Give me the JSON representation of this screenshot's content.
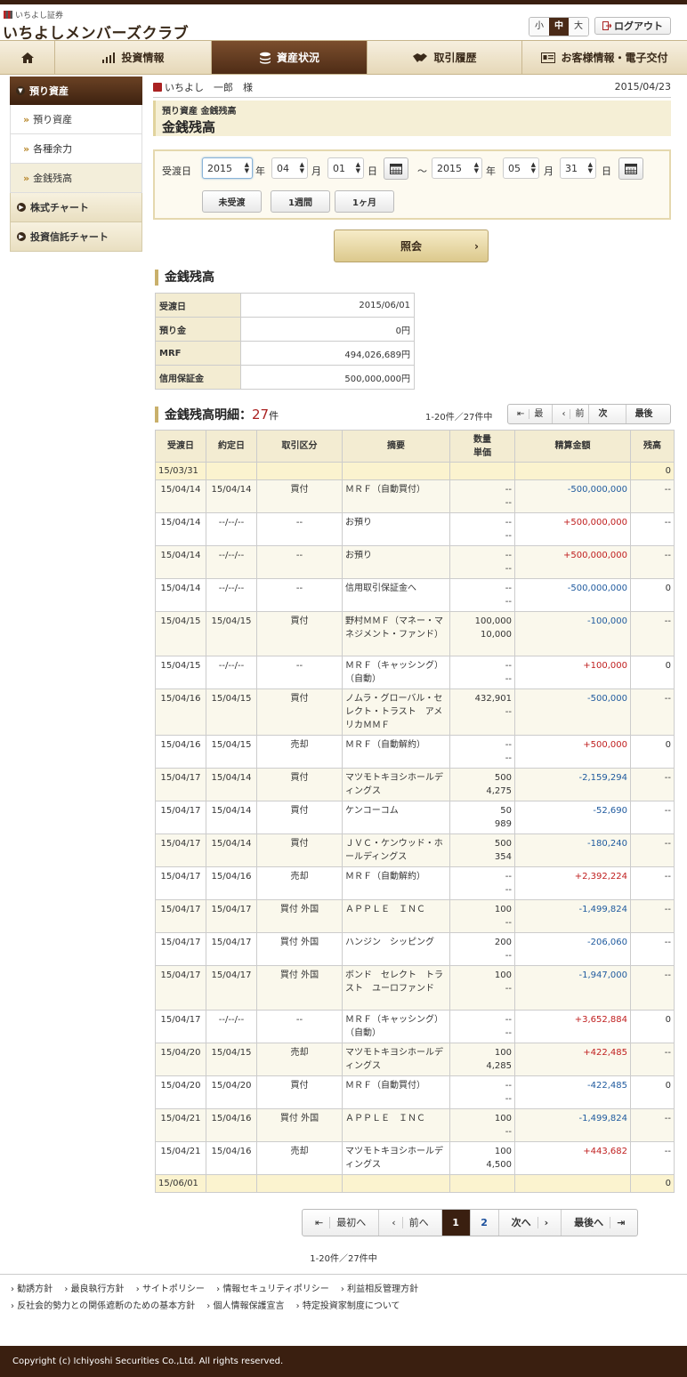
{
  "header": {
    "company_small": "いちよし証券",
    "site_title": "いちよしメンバーズクラブ",
    "font_sizes": [
      "小",
      "中",
      "大"
    ],
    "logout": "ログアウト"
  },
  "nav": {
    "items": [
      "投資情報",
      "資産状況",
      "取引履歴",
      "お客様情報・電子交付"
    ]
  },
  "sidebar": {
    "head": "預り資産",
    "items": [
      "預り資産",
      "各種余力",
      "金銭残高"
    ],
    "cats": [
      "株式チャート",
      "投資信託チャート"
    ]
  },
  "user": {
    "name": "いちよし　一郎　様",
    "date": "2015/04/23"
  },
  "page": {
    "breadcrumb": "預り資産 金銭残高",
    "title": "金銭残高"
  },
  "filter": {
    "label": "受渡日",
    "from": {
      "year": "2015",
      "month": "04",
      "day": "01"
    },
    "to": {
      "year": "2015",
      "month": "05",
      "day": "31"
    },
    "year_unit": "年",
    "month_unit": "月",
    "day_unit": "日",
    "tilde": "～",
    "buttons": [
      "未受渡",
      "1週間",
      "1ヶ月"
    ],
    "submit": "照会"
  },
  "balance": {
    "title": "金銭残高",
    "rows": [
      {
        "k": "受渡日",
        "v": "2015/06/01"
      },
      {
        "k": "預り金",
        "v": "0円"
      },
      {
        "k": "MRF",
        "v": "494,026,689円"
      },
      {
        "k": "信用保証金",
        "v": "500,000,000円"
      }
    ]
  },
  "detail": {
    "title": "金銭残高明細：",
    "count": "27",
    "count_unit": "件",
    "range": "1-20件／27件中",
    "pager_small": [
      "最初へ",
      "前へ",
      "次へ",
      "最後へ"
    ],
    "headers": [
      "受渡日",
      "約定日",
      "取引区分",
      "摘要",
      "数量",
      "単価",
      "精算金額",
      "残高"
    ],
    "first_row": {
      "date": "15/03/31",
      "balance": "0"
    },
    "rows": [
      {
        "d1": "15/04/14",
        "d2": "15/04/14",
        "kind": "買付",
        "desc": "ＭＲＦ（自動買付）",
        "q": "--",
        "p": "--",
        "amt": "-500,000,000",
        "sign": "neg",
        "bal": "--"
      },
      {
        "d1": "15/04/14",
        "d2": "--/--/--",
        "kind": "--",
        "desc": "お預り",
        "q": "--",
        "p": "--",
        "amt": "+500,000,000",
        "sign": "pos",
        "bal": "--"
      },
      {
        "d1": "15/04/14",
        "d2": "--/--/--",
        "kind": "--",
        "desc": "お預り",
        "q": "--",
        "p": "--",
        "amt": "+500,000,000",
        "sign": "pos",
        "bal": "--"
      },
      {
        "d1": "15/04/14",
        "d2": "--/--/--",
        "kind": "--",
        "desc": "信用取引保証金へ",
        "q": "--",
        "p": "--",
        "amt": "-500,000,000",
        "sign": "neg",
        "bal": "0"
      },
      {
        "d1": "15/04/15",
        "d2": "15/04/15",
        "kind": "買付",
        "desc": "野村ＭＭＦ（マネー・マネジメント・ファンド）",
        "q": "100,000",
        "p": "10,000",
        "amt": "-100,000",
        "sign": "neg",
        "bal": "--"
      },
      {
        "d1": "15/04/15",
        "d2": "--/--/--",
        "kind": "--",
        "desc": "ＭＲＦ（キャッシング）（自動）",
        "q": "--",
        "p": "--",
        "amt": "+100,000",
        "sign": "pos",
        "bal": "0"
      },
      {
        "d1": "15/04/16",
        "d2": "15/04/15",
        "kind": "買付",
        "desc": "ノムラ・グローバル・セレクト・トラスト　アメリカＭＭＦ",
        "q": "432,901",
        "p": "--",
        "amt": "-500,000",
        "sign": "neg",
        "bal": "--"
      },
      {
        "d1": "15/04/16",
        "d2": "15/04/15",
        "kind": "売却",
        "desc": "ＭＲＦ（自動解約）",
        "q": "--",
        "p": "--",
        "amt": "+500,000",
        "sign": "pos",
        "bal": "0"
      },
      {
        "d1": "15/04/17",
        "d2": "15/04/14",
        "kind": "買付",
        "desc": "マツモトキヨシホールディングス",
        "q": "500",
        "p": "4,275",
        "amt": "-2,159,294",
        "sign": "neg",
        "bal": "--"
      },
      {
        "d1": "15/04/17",
        "d2": "15/04/14",
        "kind": "買付",
        "desc": "ケンコーコム",
        "q": "50",
        "p": "989",
        "amt": "-52,690",
        "sign": "neg",
        "bal": "--"
      },
      {
        "d1": "15/04/17",
        "d2": "15/04/14",
        "kind": "買付",
        "desc": "ＪＶＣ・ケンウッド・ホールディングス",
        "q": "500",
        "p": "354",
        "amt": "-180,240",
        "sign": "neg",
        "bal": "--"
      },
      {
        "d1": "15/04/17",
        "d2": "15/04/16",
        "kind": "売却",
        "desc": "ＭＲＦ（自動解約）",
        "q": "--",
        "p": "--",
        "amt": "+2,392,224",
        "sign": "pos",
        "bal": "--"
      },
      {
        "d1": "15/04/17",
        "d2": "15/04/17",
        "kind": "買付 外国",
        "desc": "ＡＰＰＬＥ　ＩＮＣ",
        "q": "100",
        "p": "--",
        "amt": "-1,499,824",
        "sign": "neg",
        "bal": "--"
      },
      {
        "d1": "15/04/17",
        "d2": "15/04/17",
        "kind": "買付 外国",
        "desc": "ハンジン　シッピング",
        "q": "200",
        "p": "--",
        "amt": "-206,060",
        "sign": "neg",
        "bal": "--"
      },
      {
        "d1": "15/04/17",
        "d2": "15/04/17",
        "kind": "買付 外国",
        "desc": "ボンド　セレクト　トラスト　ユーロファンド",
        "q": "100",
        "p": "--",
        "amt": "-1,947,000",
        "sign": "neg",
        "bal": "--"
      },
      {
        "d1": "15/04/17",
        "d2": "--/--/--",
        "kind": "--",
        "desc": "ＭＲＦ（キャッシング）（自動）",
        "q": "--",
        "p": "--",
        "amt": "+3,652,884",
        "sign": "pos",
        "bal": "0"
      },
      {
        "d1": "15/04/20",
        "d2": "15/04/15",
        "kind": "売却",
        "desc": "マツモトキヨシホールディングス",
        "q": "100",
        "p": "4,285",
        "amt": "+422,485",
        "sign": "pos",
        "bal": "--"
      },
      {
        "d1": "15/04/20",
        "d2": "15/04/20",
        "kind": "買付",
        "desc": "ＭＲＦ（自動買付）",
        "q": "--",
        "p": "--",
        "amt": "-422,485",
        "sign": "neg",
        "bal": "0"
      },
      {
        "d1": "15/04/21",
        "d2": "15/04/16",
        "kind": "買付 外国",
        "desc": "ＡＰＰＬＥ　ＩＮＣ",
        "q": "100",
        "p": "--",
        "amt": "-1,499,824",
        "sign": "neg",
        "bal": "--"
      },
      {
        "d1": "15/04/21",
        "d2": "15/04/16",
        "kind": "売却",
        "desc": "マツモトキヨシホールディングス",
        "q": "100",
        "p": "4,500",
        "amt": "+443,682",
        "sign": "pos",
        "bal": "--"
      }
    ],
    "last_row": {
      "date": "15/06/01",
      "balance": "0"
    },
    "pager": {
      "first": "最初へ",
      "prev": "前へ",
      "p1": "1",
      "p2": "2",
      "next": "次へ",
      "last": "最後へ"
    }
  },
  "footer": {
    "links": [
      "勧誘方針",
      "最良執行方針",
      "サイトポリシー",
      "情報セキュリティポリシー",
      "利益相反管理方針",
      "反社会的勢力との関係遮断のための基本方針",
      "個人情報保護宣言",
      "特定投資家制度について"
    ],
    "copyright": "Copyright (c) Ichiyoshi Securities Co.,Ltd. All rights reserved."
  }
}
